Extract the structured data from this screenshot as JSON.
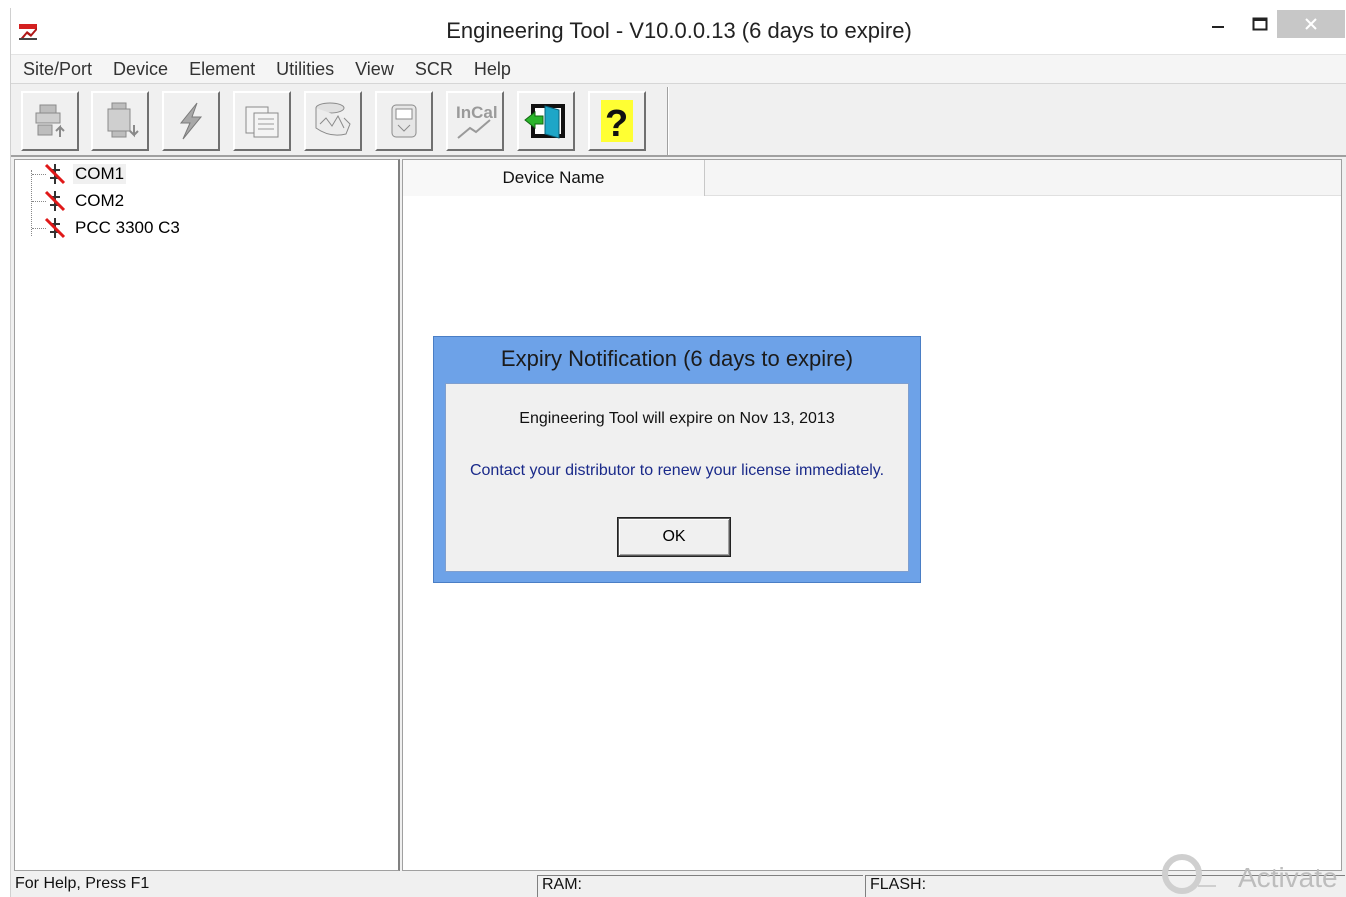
{
  "window": {
    "title": "Engineering Tool - V10.0.0.13 (6 days to expire)",
    "app_icon": "ens-app-icon",
    "controls": {
      "minimize_icon": "minimize-icon",
      "maximize_icon": "maximize-icon",
      "close_icon": "close-icon"
    }
  },
  "menu": [
    "Site/Port",
    "Device",
    "Element",
    "Utilities",
    "View",
    "SCR",
    "Help"
  ],
  "toolbar": {
    "buttons": [
      {
        "icon": "upload-device-icon",
        "enabled": false
      },
      {
        "icon": "download-device-icon",
        "enabled": false
      },
      {
        "icon": "lightning-icon",
        "enabled": false
      },
      {
        "icon": "document-icon",
        "enabled": false
      },
      {
        "icon": "chart-roll-icon",
        "enabled": false
      },
      {
        "icon": "device-panel-icon",
        "enabled": false
      },
      {
        "icon": "incal-icon",
        "label": "InCal",
        "enabled": false
      },
      {
        "icon": "exit-door-icon",
        "enabled": true
      },
      {
        "icon": "help-question-icon",
        "label": "?",
        "enabled": true
      }
    ]
  },
  "tree": {
    "items": [
      {
        "label": "COM1",
        "icon": "disconnected-port-icon",
        "selected": true
      },
      {
        "label": "COM2",
        "icon": "disconnected-port-icon",
        "selected": false
      },
      {
        "label": "PCC 3300 C3",
        "icon": "disconnected-port-icon",
        "selected": false
      }
    ]
  },
  "list": {
    "columns": [
      "Device Name"
    ]
  },
  "dialog": {
    "title": "Expiry Notification (6 days to expire)",
    "message": "Engineering Tool will expire on Nov 13, 2013",
    "message2": "Contact your distributor to renew your license immediately.",
    "ok_label": "OK"
  },
  "statusbar": {
    "help": "For Help, Press F1",
    "ram": "RAM:",
    "flash": "FLASH:"
  },
  "watermark": {
    "text": "Activate"
  },
  "colors": {
    "dialog_frame": "#6da2e8",
    "dialog_link_text": "#1a2a8a",
    "close_button": "#c7c7c7"
  }
}
